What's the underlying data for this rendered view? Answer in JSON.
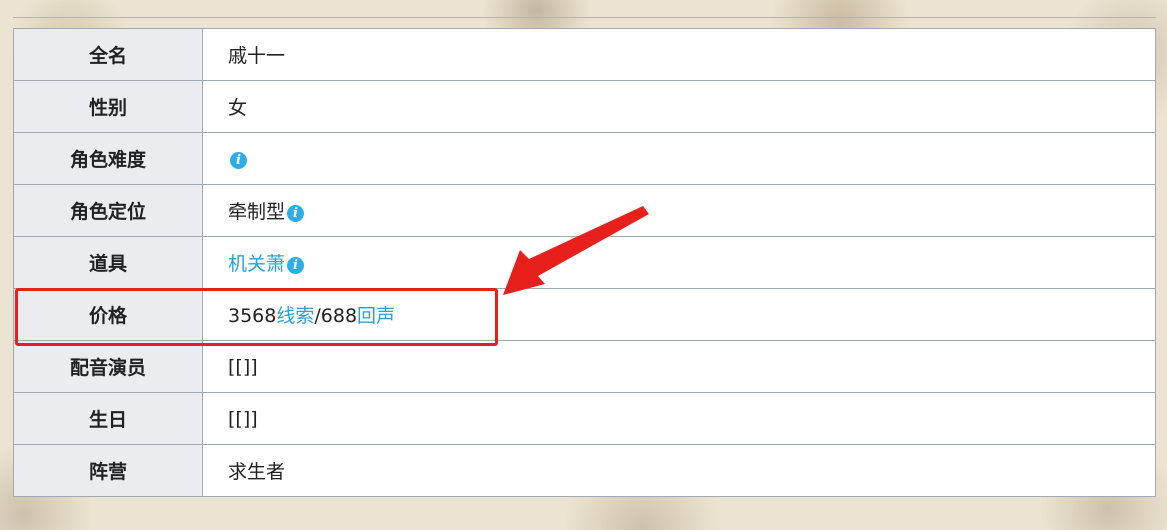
{
  "table": {
    "rows": [
      {
        "label": "全名",
        "value": "戚十一"
      },
      {
        "label": "性别",
        "value": "女"
      },
      {
        "label": "角色难度",
        "icon": "info-icon"
      },
      {
        "label": "角色定位",
        "value": "牵制型",
        "icon": "info-icon"
      },
      {
        "label": "道具",
        "link": "机关萧",
        "icon": "info-icon"
      },
      {
        "label": "价格",
        "price": {
          "clue_amount": "3568",
          "clue_label": "线索",
          "separator": "/",
          "echo_amount": "688",
          "echo_label": "回声"
        }
      },
      {
        "label": "配音演员",
        "value": "[[]]"
      },
      {
        "label": "生日",
        "value": "[[]]"
      },
      {
        "label": "阵营",
        "value": "求生者"
      }
    ]
  },
  "info_icon_glyph": "i",
  "colors": {
    "link": "#26a2d8",
    "info_icon": "#2eaee8",
    "annotation": "#e8201c",
    "header_bg": "#eaecf0",
    "border": "#a2a9b1"
  }
}
